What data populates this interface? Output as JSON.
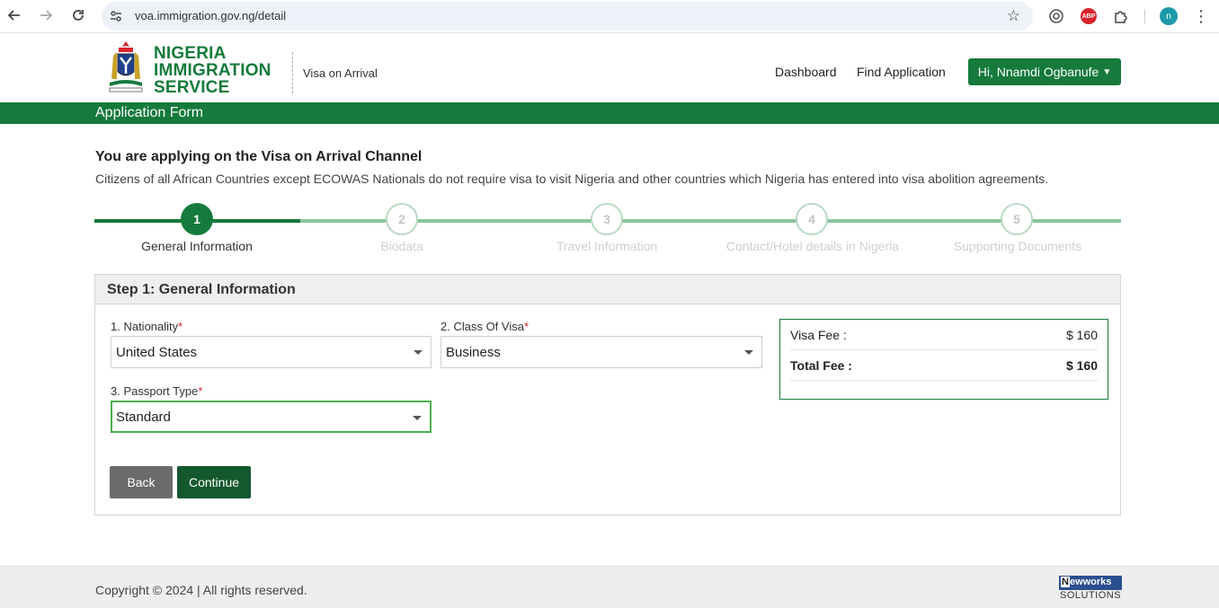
{
  "browser": {
    "url": "voa.immigration.gov.ng/detail",
    "profile_initial": "n",
    "abp_label": "ABP"
  },
  "header": {
    "brand_lines": [
      "NIGERIA",
      "IMMIGRATION",
      "SERVICE"
    ],
    "subtitle": "Visa on Arrival",
    "nav": [
      "Dashboard",
      "Find Application"
    ],
    "user_label": "Hi, Nnamdi Ogbanufe"
  },
  "band": {
    "title": "Application Form"
  },
  "intro": {
    "title": "You are applying on the Visa on Arrival Channel",
    "text": "Citizens of all African Countries except ECOWAS Nationals do not require visa to visit Nigeria and other countries which Nigeria has entered into visa abolition agreements."
  },
  "steps": [
    {
      "number": "1",
      "label": "General Information",
      "active": true
    },
    {
      "number": "2",
      "label": "Biodata",
      "active": false
    },
    {
      "number": "3",
      "label": "Travel Information",
      "active": false
    },
    {
      "number": "4",
      "label": "Contact/Hotel details in Nigeria",
      "active": false
    },
    {
      "number": "5",
      "label": "Supporting Documents",
      "active": false
    }
  ],
  "form": {
    "heading": "Step 1: General Information",
    "nationality": {
      "label": "1. Nationality",
      "value": "United States"
    },
    "visa_class": {
      "label": "2. Class Of Visa",
      "value": "Business"
    },
    "passport_type": {
      "label": "3. Passport Type",
      "value": "Standard"
    },
    "required_mark": "*",
    "back_label": "Back",
    "continue_label": "Continue"
  },
  "fees": {
    "visa_fee_label": "Visa Fee :",
    "visa_fee_value": "$ 160",
    "total_fee_label": "Total Fee :",
    "total_fee_value": "$ 160"
  },
  "footer": {
    "copyright": "Copyright © 2024 | All rights reserved.",
    "vendor_top_initial": "N",
    "vendor_top_rest": "ewworks",
    "vendor_bottom": "SOLUTIONS"
  },
  "colors": {
    "brand_green": "#157a3b",
    "dark_green": "#14582e",
    "required": "#d9232d"
  }
}
